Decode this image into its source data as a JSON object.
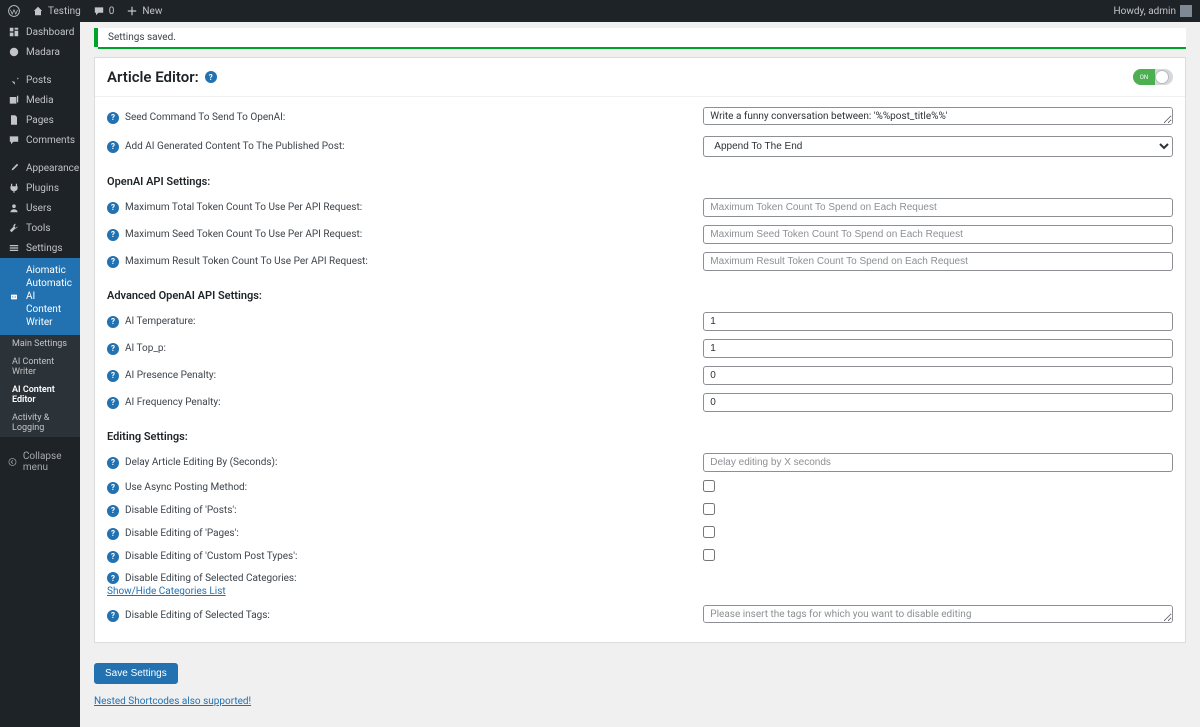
{
  "adminbar": {
    "site": "Testing",
    "comments_count": "0",
    "new": "New",
    "howdy": "Howdy, admin"
  },
  "sidebar": {
    "dashboard": "Dashboard",
    "madara": "Madara",
    "posts": "Posts",
    "media": "Media",
    "pages": "Pages",
    "comments": "Comments",
    "appearance": "Appearance",
    "plugins": "Plugins",
    "users": "Users",
    "tools": "Tools",
    "settings": "Settings",
    "aiomatic": "Aiomatic Automatic AI Content Writer",
    "sub": {
      "main": "Main Settings",
      "writer": "AI Content Writer",
      "editor": "AI Content Editor",
      "activity": "Activity & Logging"
    },
    "collapse": "Collapse menu"
  },
  "notice": "Settings saved.",
  "panel": {
    "title": "Article Editor:",
    "toggle_on": "ON"
  },
  "fields": {
    "seed_label": "Seed Command To Send To OpenAI:",
    "seed_value": "Write a funny conversation between: '%%post_title%%'",
    "append_label": "Add AI Generated Content To The Published Post:",
    "append_value": "Append To The End",
    "openai_heading": "OpenAI API Settings:",
    "max_total_label": "Maximum Total Token Count To Use Per API Request:",
    "max_total_ph": "Maximum Token Count To Spend on Each Request",
    "max_seed_label": "Maximum Seed Token Count To Use Per API Request:",
    "max_seed_ph": "Maximum Seed Token Count To Spend on Each Request",
    "max_result_label": "Maximum Result Token Count To Use Per API Request:",
    "max_result_ph": "Maximum Result Token Count To Spend on Each Request",
    "adv_heading": "Advanced OpenAI API Settings:",
    "temp_label": "AI Temperature:",
    "temp_value": "1",
    "topp_label": "AI Top_p:",
    "topp_value": "1",
    "presence_label": "AI Presence Penalty:",
    "presence_value": "0",
    "freq_label": "AI Frequency Penalty:",
    "freq_value": "0",
    "edit_heading": "Editing Settings:",
    "delay_label": "Delay Article Editing By (Seconds):",
    "delay_ph": "Delay editing by X seconds",
    "async_label": "Use Async Posting Method:",
    "disable_posts_label": "Disable Editing of 'Posts':",
    "disable_pages_label": "Disable Editing of 'Pages':",
    "disable_cpt_label": "Disable Editing of 'Custom Post Types':",
    "disable_cat_label": "Disable Editing of Selected Categories:",
    "showhide_cats": "Show/Hide Categories List",
    "disable_tags_label": "Disable Editing of Selected Tags:",
    "disable_tags_ph": "Please insert the tags for which you want to disable editing"
  },
  "save": "Save Settings",
  "footnote": "Nested Shortcodes also supported!"
}
